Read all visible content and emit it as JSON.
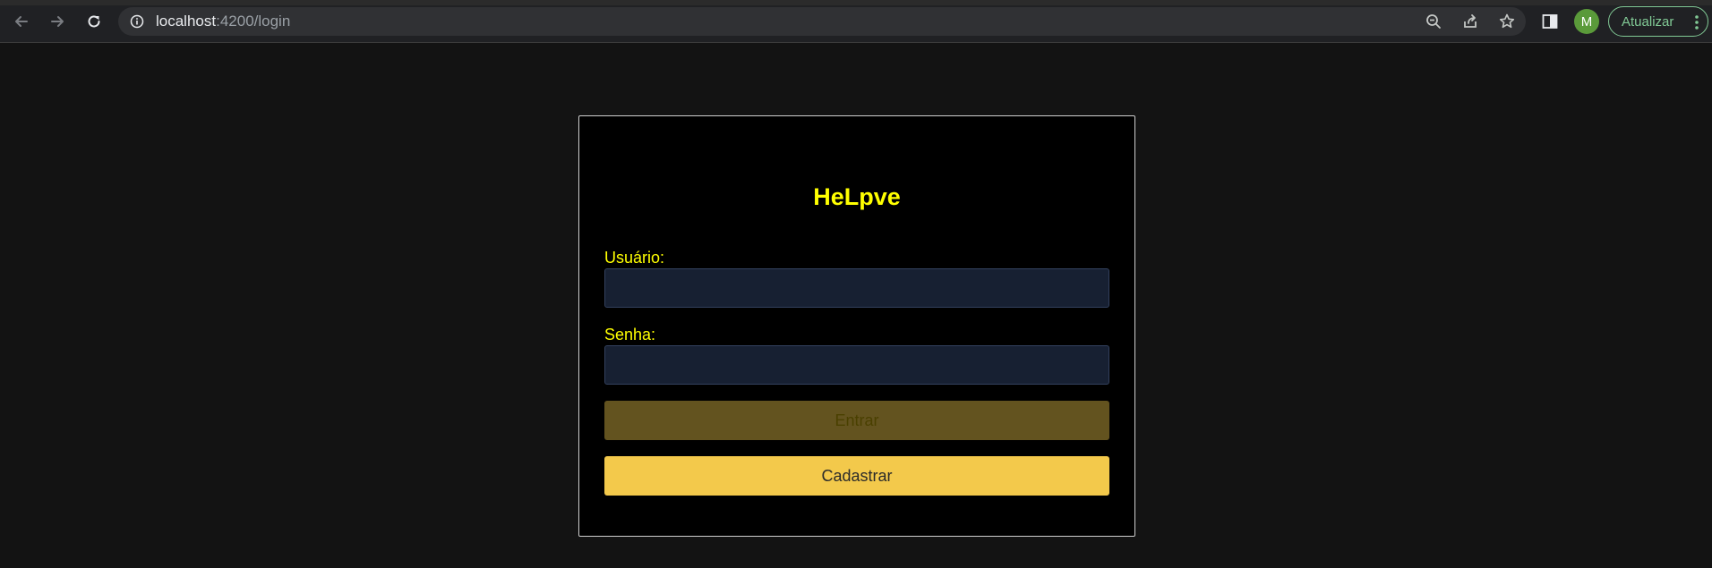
{
  "browser": {
    "url_host": "localhost",
    "url_path": ":4200/login",
    "profile_initial": "M",
    "update_label": "Atualizar",
    "icons": {
      "back": "arrow-left-icon",
      "forward": "arrow-right-icon",
      "reload": "reload-icon",
      "site_info": "info-icon",
      "zoom": "zoom-out-icon",
      "share": "share-icon",
      "bookmark": "star-icon",
      "side_panel": "side-panel-icon",
      "menu": "kebab-menu-icon"
    }
  },
  "login": {
    "brand": "HeLpve",
    "username_label": "Usuário:",
    "username_value": "",
    "password_label": "Senha:",
    "password_value": "",
    "submit_label": "Entrar",
    "register_label": "Cadastrar"
  },
  "colors": {
    "page_background": "#131313",
    "card_background": "#000000",
    "accent_yellow": "#ffff00",
    "input_background": "#172032",
    "button_disabled": "#63531f",
    "button_primary": "#f3c94b",
    "update_green": "#81c995",
    "avatar_green": "#5a9a3a"
  }
}
